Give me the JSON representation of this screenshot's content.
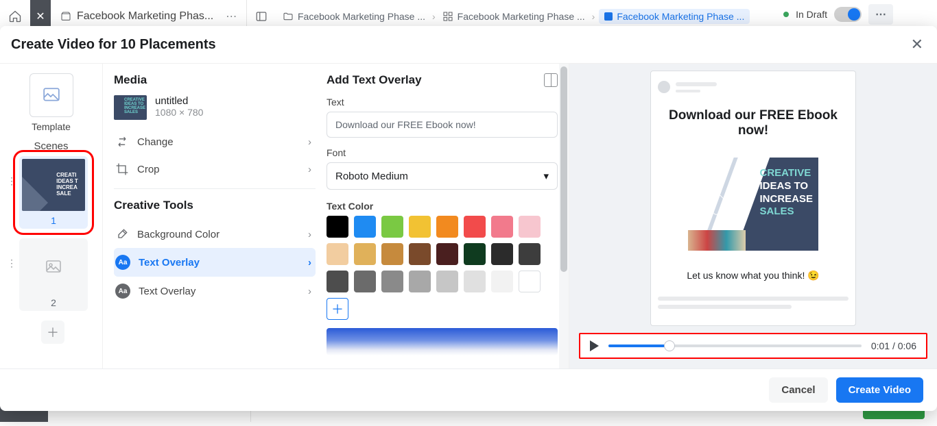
{
  "app": {
    "tab_closed_label": "✕",
    "breadcrumb_tab": "Facebook Marketing Phas..."
  },
  "breadcrumb": {
    "items": [
      "Facebook Marketing Phase ...",
      "Facebook Marketing Phase ...",
      "Facebook Marketing Phase ..."
    ]
  },
  "status": {
    "label": "In Draft"
  },
  "modal": {
    "title": "Create Video for 10 Placements",
    "footer": {
      "cancel": "Cancel",
      "create": "Create Video"
    }
  },
  "rail": {
    "template_label": "Template",
    "scenes_heading": "Scenes",
    "scene1_num": "1",
    "scene1_thumb_text": "CREATI\nIDEAS T\nINCREA\nSALE",
    "scene2_num": "2"
  },
  "media": {
    "section": "Media",
    "name": "untitled",
    "dims": "1080 × 780",
    "change": "Change",
    "crop": "Crop"
  },
  "tools": {
    "section": "Creative Tools",
    "bg_color": "Background Color",
    "overlay_active": "Text Overlay",
    "overlay2": "Text Overlay"
  },
  "overlay": {
    "heading": "Add Text Overlay",
    "text_label": "Text",
    "text_value": "Download our FREE Ebook now!",
    "font_label": "Font",
    "font_value": "Roboto Medium",
    "color_label": "Text Color"
  },
  "colors": {
    "row1": [
      "#000000",
      "#1f8bf2",
      "#7ac943",
      "#f2c233",
      "#f28a1f",
      "#f24b4b",
      "#f27a8c",
      "#f7c6cf"
    ],
    "row2": [
      "#f2cda0",
      "#e0b15a",
      "#c68a3d",
      "#7a4a2b",
      "#4a1f1f",
      "#0f3b1f",
      "#2b2b2b",
      "#3d3d3d"
    ],
    "row3": [
      "#4d4d4d",
      "#6b6b6b",
      "#8a8a8a",
      "#a8a8a8",
      "#c6c6c6",
      "#e0e0e0",
      "#f2f2f2",
      "#ffffff"
    ]
  },
  "preview": {
    "overlay_text": "Download our FREE Ebook now!",
    "hero_lines": {
      "l1": "CREATIVE",
      "l2": "IDEAS TO",
      "l3": "INCREASE",
      "l4": "SALES"
    },
    "caption": "Let us know what you think! 😉"
  },
  "player": {
    "current": "0:01",
    "total": "0:06",
    "sep": " / "
  }
}
